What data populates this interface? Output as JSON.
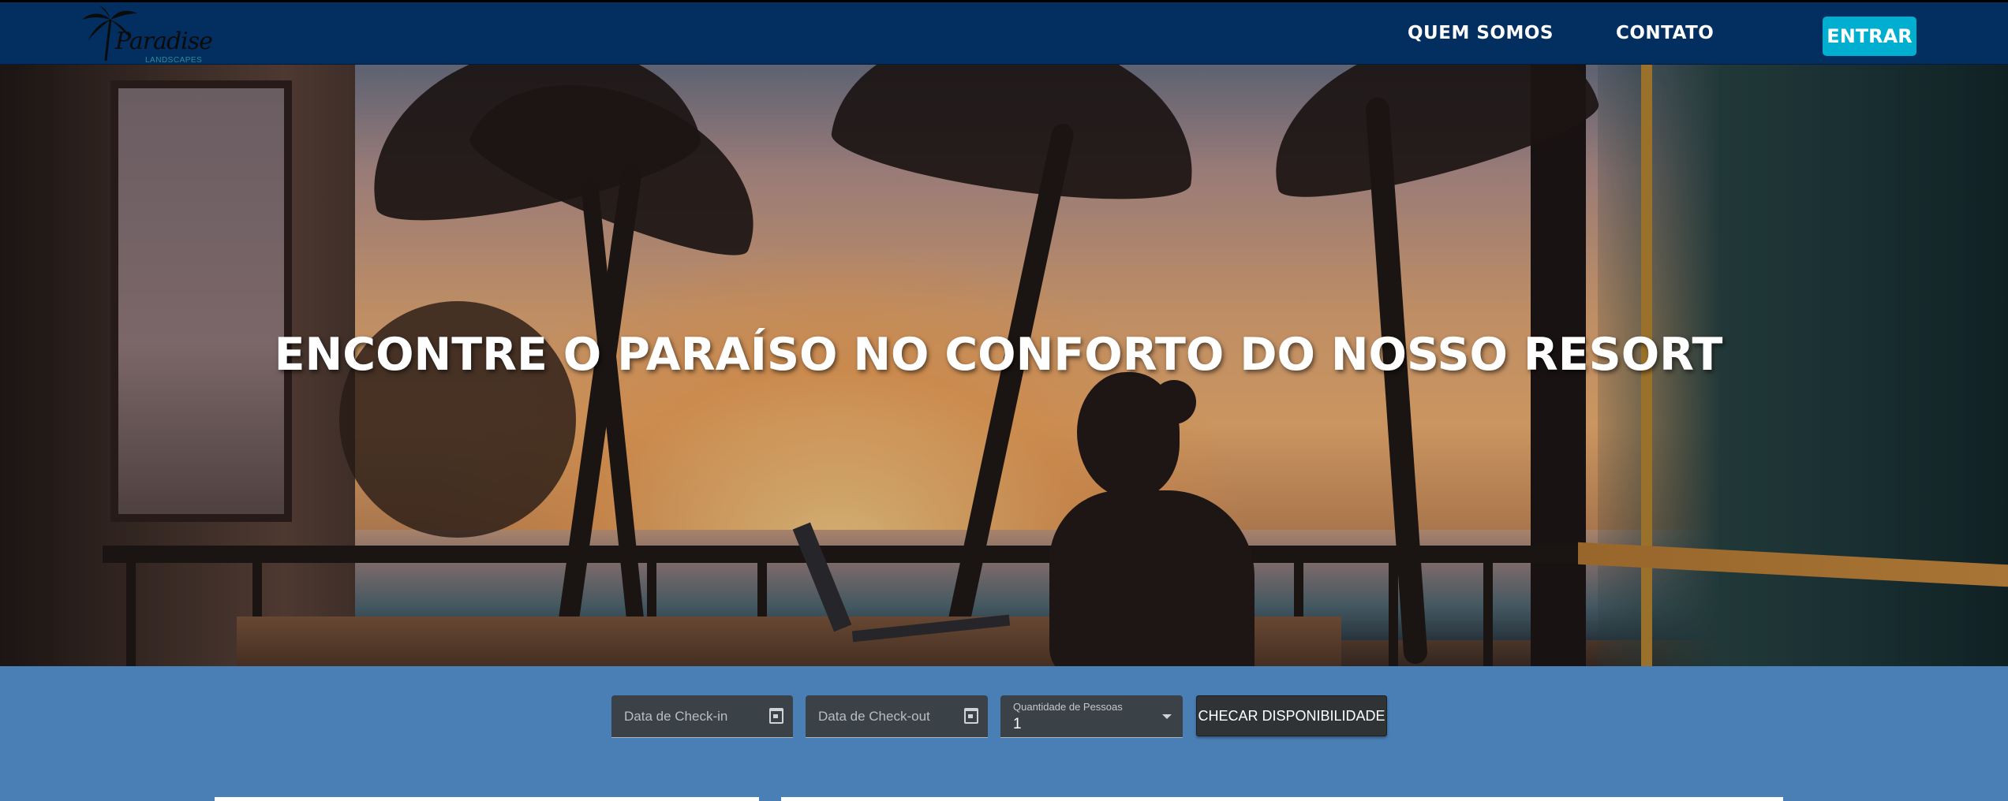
{
  "brand": {
    "logo_word": "Paradise",
    "logo_sub": "LANDSCAPES"
  },
  "nav": {
    "links": [
      "QUEM SOMOS",
      "CONTATO"
    ],
    "login_label": "ENTRAR"
  },
  "hero": {
    "title": "ENCONTRE O PARAÍSO NO CONFORTO DO NOSSO RESORT"
  },
  "booking": {
    "checkin_placeholder": "Data de Check-in",
    "checkout_placeholder": "Data de Check-out",
    "guests_label": "Quantidade de Pessoas",
    "guests_value": "1",
    "check_button": "CHECAR DISPONIBILIDADE"
  },
  "colors": {
    "navbar": "#032e60",
    "accent": "#00aecf",
    "booking_bg": "#4a7fb5"
  }
}
